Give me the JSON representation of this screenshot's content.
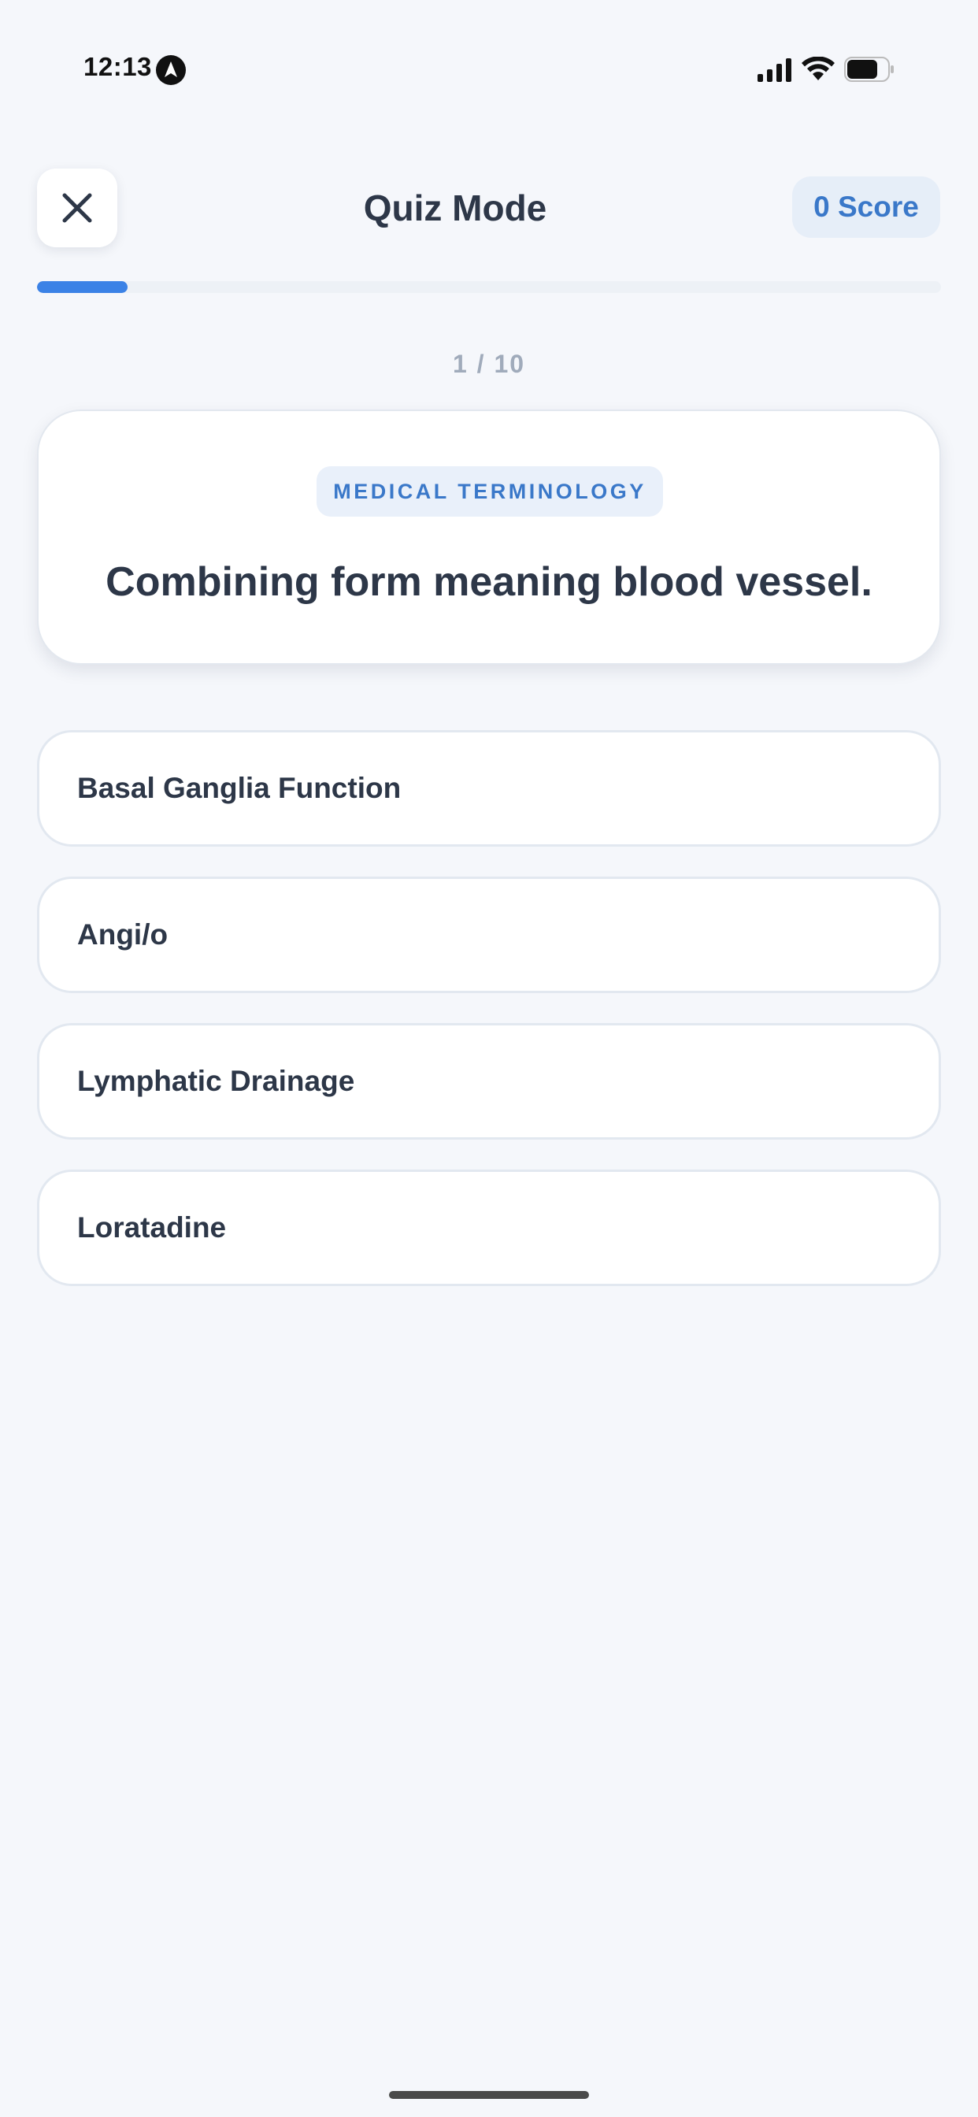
{
  "status_bar": {
    "time": "12:13",
    "icons": [
      "location-arrow-icon",
      "cellular-signal-icon",
      "wifi-icon",
      "battery-icon"
    ]
  },
  "header": {
    "close_icon": "close-icon",
    "title": "Quiz Mode",
    "score_label": "0 Score"
  },
  "progress": {
    "current": 1,
    "total": 10,
    "fraction": 0.1,
    "counter_text": "1 / 10"
  },
  "question": {
    "category": "MEDICAL TERMINOLOGY",
    "text": "Combining form meaning blood vessel."
  },
  "answers": [
    {
      "label": "Basal Ganglia Function"
    },
    {
      "label": "Angi/o"
    },
    {
      "label": "Lymphatic Drainage"
    },
    {
      "label": "Loratadine"
    }
  ],
  "colors": {
    "background": "#f5f7fb",
    "accent": "#3b82e6",
    "accent_text": "#3a78c9",
    "text_primary": "#2d3748",
    "text_muted": "#a0abbb"
  }
}
